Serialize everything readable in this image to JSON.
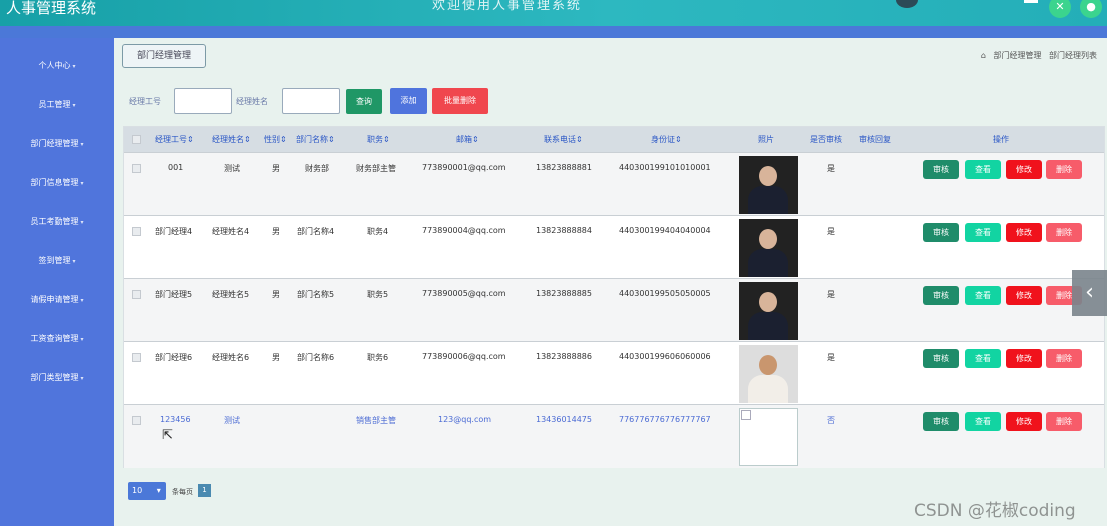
{
  "app": {
    "title": "人事管理系统",
    "top_center": "欢迎使用人事管理系统"
  },
  "colors": {
    "sidebar": "#5075dc",
    "topbar": "#24aeb8",
    "query": "#1f9766",
    "add": "#4f74dd",
    "batch_delete": "#f0474e",
    "review": "#1f8c6a",
    "view": "#12d4a2",
    "edit": "#f0121c",
    "delete": "#f75c6a"
  },
  "sidebar": {
    "items": [
      {
        "label": "个人中心"
      },
      {
        "label": "员工管理"
      },
      {
        "label": "部门经理管理"
      },
      {
        "label": "部门信息管理"
      },
      {
        "label": "员工考勤管理"
      },
      {
        "label": "签到管理"
      },
      {
        "label": "请假申请管理"
      },
      {
        "label": "工资查询管理"
      },
      {
        "label": "部门类型管理"
      }
    ]
  },
  "breadcrumb": {
    "box_label": "部门经理管理",
    "home_icon": "home-icon",
    "level1": "部门经理管理",
    "level2": "部门经理列表"
  },
  "search": {
    "field1_label": "经理工号",
    "field1_value": "",
    "field2_label": "经理姓名",
    "field2_value": "",
    "query_label": "查询",
    "add_label": "添加",
    "batch_delete_label": "批量删除"
  },
  "table": {
    "headers": [
      "经理工号",
      "经理姓名",
      "性别",
      "部门名称",
      "职务",
      "邮箱",
      "联系电话",
      "身份证",
      "照片",
      "是否审核",
      "审核回复",
      "操作"
    ],
    "rows": [
      {
        "id": "001",
        "name": "测试",
        "gender": "男",
        "dept": "财务部",
        "position": "财务部主管",
        "email": "773890001@qq.com",
        "phone": "13823888881",
        "idcard": "440300199101010001",
        "audited": "是",
        "reply": ""
      },
      {
        "id": "部门经理4",
        "name": "经理姓名4",
        "gender": "男",
        "dept": "部门名称4",
        "position": "职务4",
        "email": "773890004@qq.com",
        "phone": "13823888884",
        "idcard": "440300199404040004",
        "audited": "是",
        "reply": ""
      },
      {
        "id": "部门经理5",
        "name": "经理姓名5",
        "gender": "男",
        "dept": "部门名称5",
        "position": "职务5",
        "email": "773890005@qq.com",
        "phone": "13823888885",
        "idcard": "440300199505050005",
        "audited": "是",
        "reply": ""
      },
      {
        "id": "部门经理6",
        "name": "经理姓名6",
        "gender": "男",
        "dept": "部门名称6",
        "position": "职务6",
        "email": "773890006@qq.com",
        "phone": "13823888886",
        "idcard": "440300199606060006",
        "audited": "是",
        "reply": ""
      },
      {
        "id": "123456",
        "name": "测试",
        "gender": "",
        "dept": "",
        "position": "销售部主管",
        "email": "123@qq.com",
        "phone": "13436014475",
        "idcard": "776776776776777767",
        "audited": "否",
        "reply": ""
      }
    ],
    "actions": {
      "review": "审核",
      "view": "查看",
      "edit": "修改",
      "delete": "删除"
    }
  },
  "pagination": {
    "page_size": "10",
    "page_size_label": "条每页",
    "current_page": "1"
  },
  "watermark": "CSDN @花椒coding"
}
